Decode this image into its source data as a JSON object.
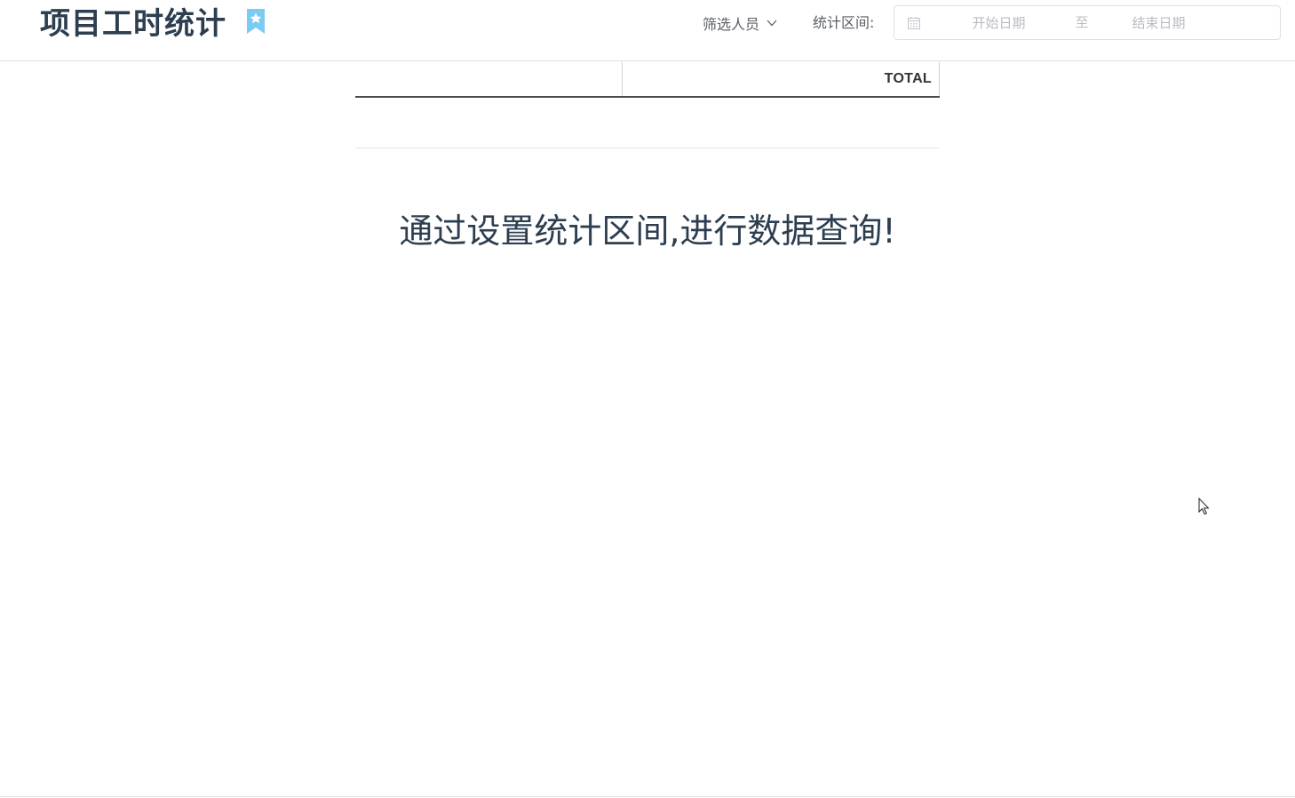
{
  "header": {
    "title": "项目工时统计",
    "filter_label": "筛选人员",
    "range_label": "统计区间:",
    "date_range": {
      "start_placeholder": "开始日期",
      "separator": "至",
      "end_placeholder": "结束日期"
    }
  },
  "table": {
    "columns": [
      "",
      "TOTAL"
    ]
  },
  "empty_message": "通过设置统计区间,进行数据查询!",
  "colors": {
    "bookmark": "#7ccbf5",
    "title": "#2c3e50",
    "placeholder": "#c0c4cc",
    "border": "#dcdfe6"
  },
  "icons": [
    "bookmark-star-icon",
    "chevron-down-icon",
    "calendar-icon",
    "mouse-cursor-icon"
  ]
}
